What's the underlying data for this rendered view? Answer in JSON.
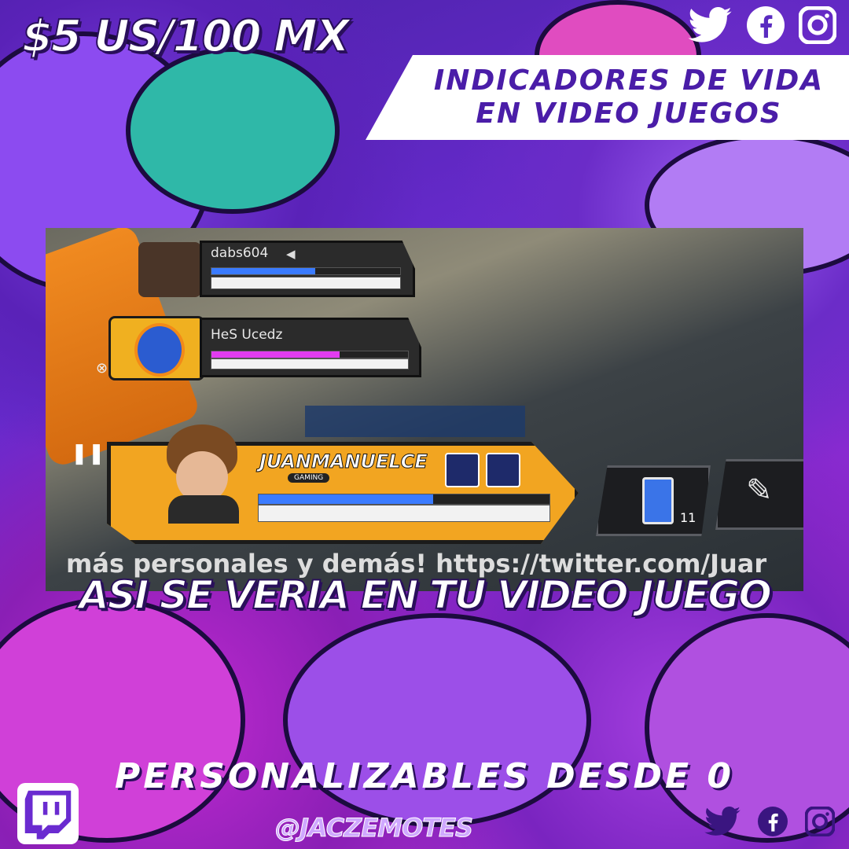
{
  "price": "$5 US/100 MX",
  "banner": {
    "line1": "INDICADORES DE VIDA",
    "line2": "EN VIDEO JUEGOS"
  },
  "video": {
    "player1": {
      "name": "dabs604",
      "shield": 0.55,
      "health": 1.0,
      "shield_color": "#3a7bff"
    },
    "player2": {
      "name": "HeS Ucedz",
      "shield": 0.65,
      "health": 1.0,
      "shield_color": "#e23cf0"
    },
    "main_player": {
      "name": "JUANMANUELCE",
      "subtitle": "GAMING",
      "shield": 0.6,
      "health": 1.0,
      "shield_color": "#3a7bff"
    },
    "item_count": "11",
    "url_text": "más personales y demás! https://twitter.com/Juar"
  },
  "caption": "ASI SE VERIA EN TU VIDEO JUEGO",
  "tagline": "PERSONALIZABLES DESDE 0",
  "handle": "@JACZEMOTES",
  "icons": {
    "twitter": "twitter-icon",
    "facebook": "facebook-icon",
    "instagram": "instagram-icon",
    "twitch": "twitch-icon"
  },
  "colors": {
    "brand_purple": "#4a1da8",
    "accent_orange": "#f2a521"
  }
}
